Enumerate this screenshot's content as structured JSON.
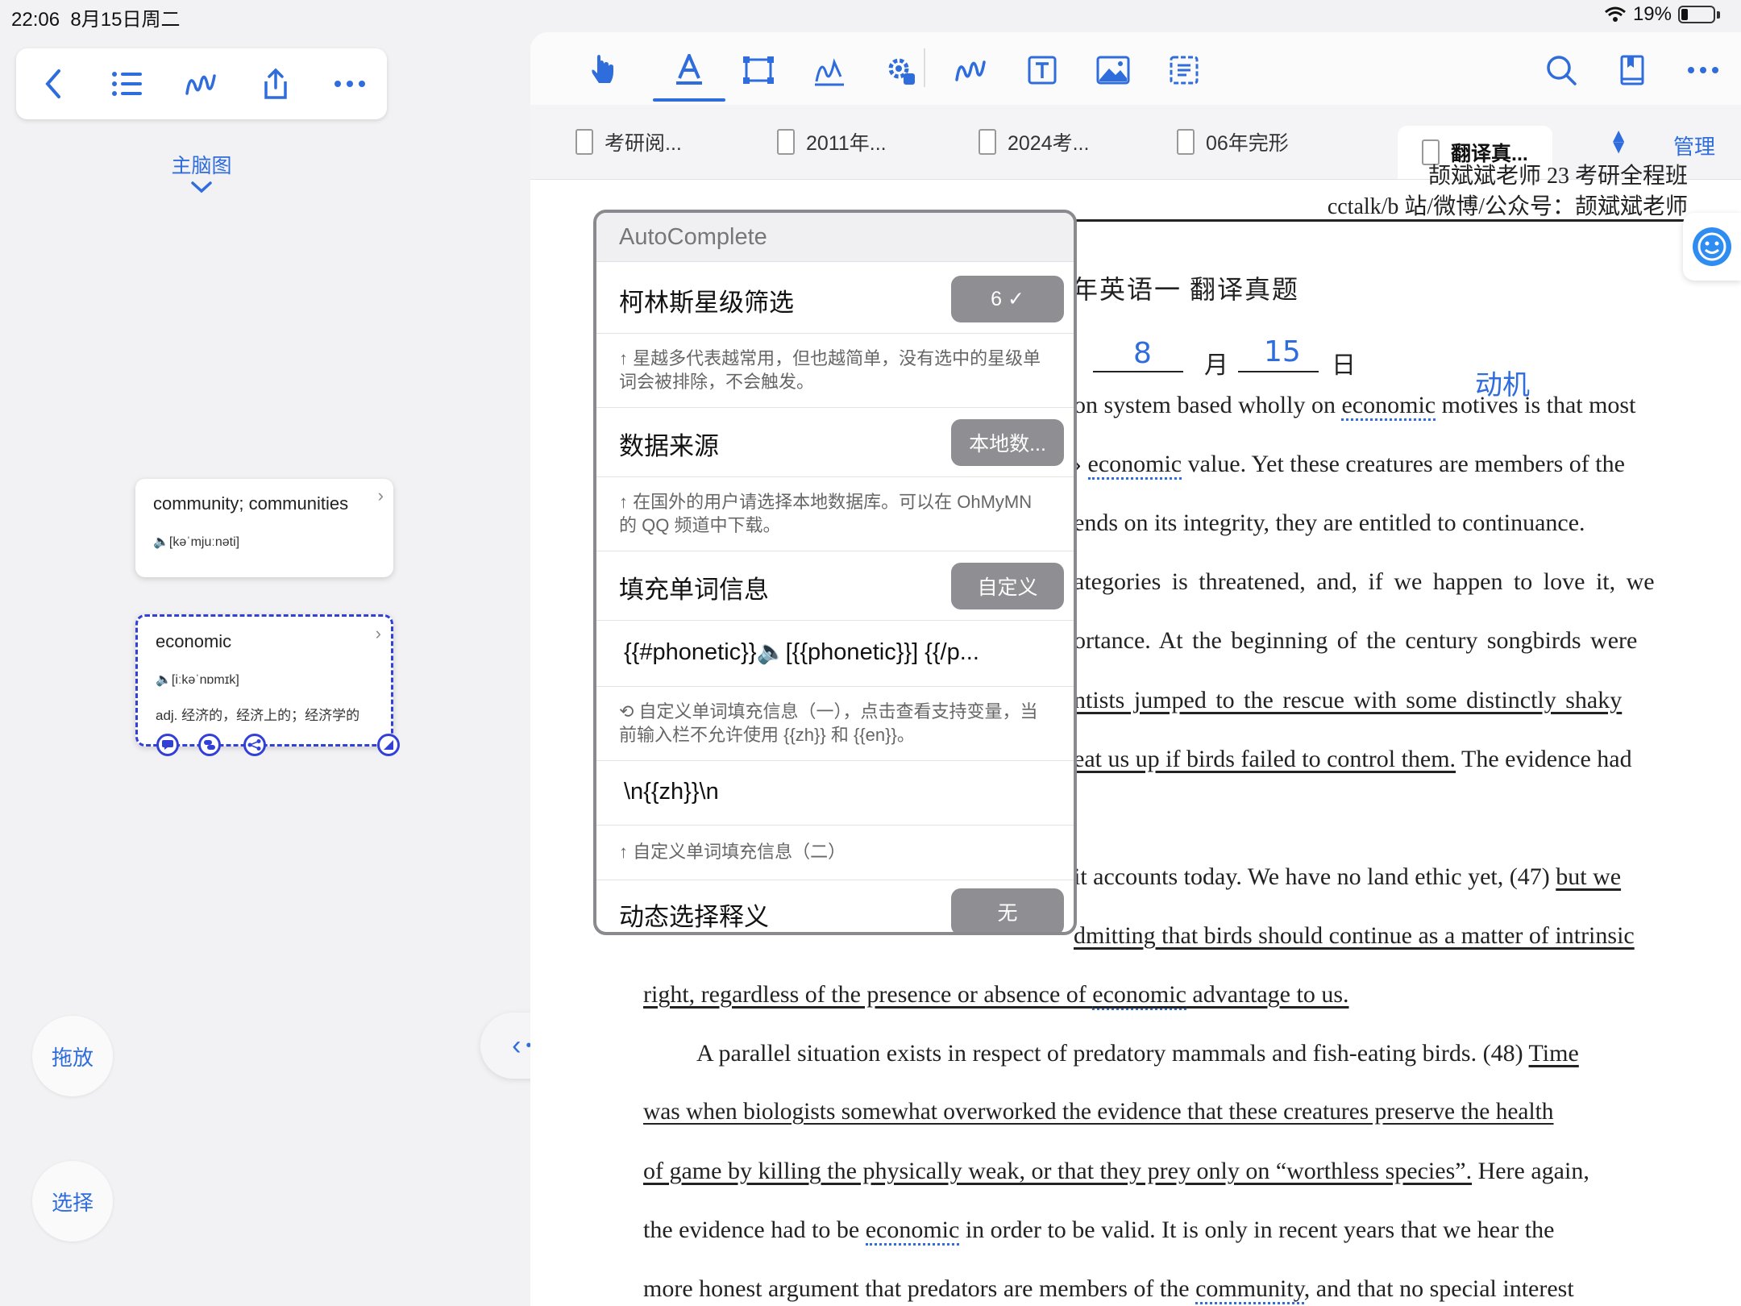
{
  "status": {
    "time": "22:06",
    "date": "8月15日周二",
    "battery": "19%"
  },
  "left": {
    "toolbar": {
      "back_icon": "chevron-left-icon",
      "list_icon": "list-icon",
      "pen_icon": "squiggle-icon",
      "share_icon": "share-icon",
      "more_icon": "more-icon"
    },
    "mindmap_label": "主脑图",
    "cards": [
      {
        "word": "community; communities",
        "phonetic": "🔈[kəˈmjuːnəti]"
      },
      {
        "word": "economic",
        "phonetic": "🔈[iːkəˈnɒmɪk]",
        "definition": "adj. 经济的，经济上的；经济学的"
      }
    ],
    "drag_label": "拖放",
    "select_label": "选择"
  },
  "tabs": [
    {
      "label": "考研阅..."
    },
    {
      "label": "2011年..."
    },
    {
      "label": "2024考..."
    },
    {
      "label": "06年完形"
    },
    {
      "label": "翻译真..."
    }
  ],
  "tabs_manage": "管理",
  "doc": {
    "header1": "颉斌斌老师 23 考研全程班",
    "header2": "cctalk/b 站/微博/公众号：颉斌斌老师",
    "title": "年英语一  翻译真题",
    "month_label": "月",
    "day_label": "日",
    "hand_month": "8",
    "hand_day": "15",
    "hand_note": "动机",
    "lines": [
      "on system based wholly on ",
      "economic",
      " motives is that most",
      "economic",
      " value. Yet these creatures are members of the",
      "ends on its integrity, they are entitled to continuance.",
      "ategories is threatened, and, if we happen to love it, we",
      "ortance. At the beginning of the century songbirds were",
      "ntists jumped to the rescue with some distinctly shaky",
      "eat us up if birds failed to control them.",
      " The evidence had",
      "it accounts today. We have no land ethic yet, (47) ",
      "but we",
      "dmitting that birds should continue as a matter of intrinsic",
      "right, regardless of the presence or absence of ",
      "economic",
      " advantage to us.",
      "A parallel situation exists in respect of predatory mammals and fish-eating birds. (48) ",
      "Time",
      "was when biologists somewhat overworked the evidence that these creatures preserve the health",
      "of game by killing the physically weak, or that they prey only on “worthless species”.",
      " Here again,",
      "the evidence had to be ",
      "economic",
      " in order to be valid. It is only in recent years that we hear the",
      "more honest argument that predators are members of the ",
      "community",
      ", and that no special interest"
    ]
  },
  "popup": {
    "title": "AutoComplete",
    "rows": [
      {
        "label": "柯林斯星级筛选",
        "button": "6 ✓"
      },
      {
        "hint": "↑ 星越多代表越常用，但也越简单，没有选中的星级单词会被排除，不会触发。"
      },
      {
        "label": "数据来源",
        "button": "本地数..."
      },
      {
        "hint": "↑ 在国外的用户请选择本地数据库。可以在 OhMyMN 的 QQ 频道中下载。"
      },
      {
        "label": "填充单词信息",
        "button": "自定义"
      },
      {
        "field": "{{#phonetic}}🔈[{{phonetic}}] {{/p..."
      },
      {
        "hint": "⟲ 自定义单词填充信息（一），点击查看支持变量，当前输入栏不允许使用 {{zh}} 和 {{en}}。"
      },
      {
        "field": "\\n{{zh}}\\n"
      },
      {
        "hint": "↑ 自定义单词填充信息（二）"
      },
      {
        "label": "动态选择释义",
        "button": "无"
      }
    ]
  }
}
